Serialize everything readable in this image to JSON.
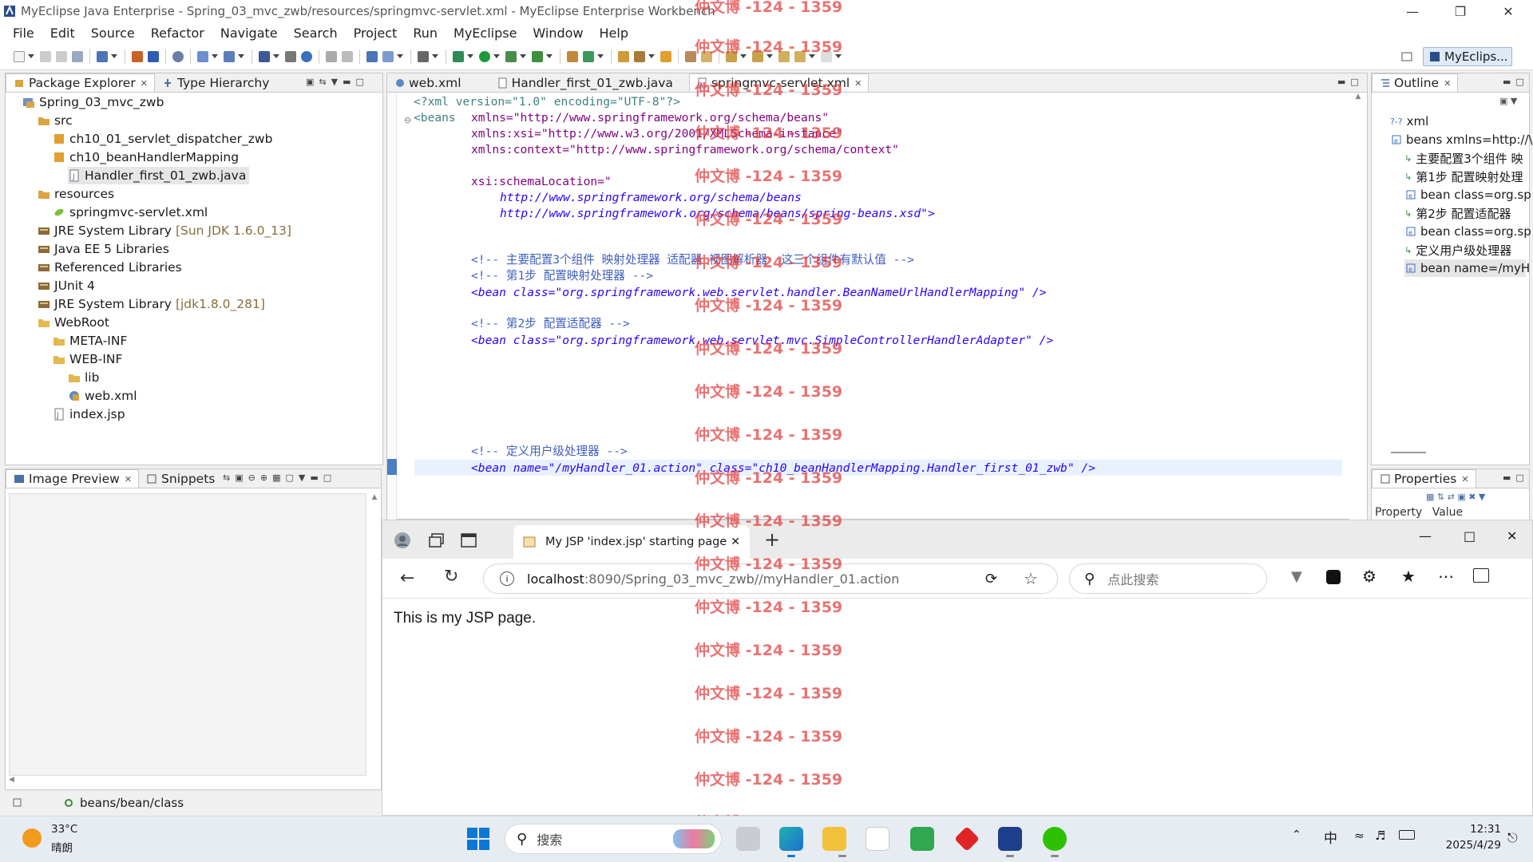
{
  "window": {
    "title": "MyEclipse Java Enterprise - Spring_03_mvc_zwb/resources/springmvc-servlet.xml - MyEclipse Enterprise Workbench"
  },
  "menu": [
    "File",
    "Edit",
    "Source",
    "Refactor",
    "Navigate",
    "Search",
    "Project",
    "Run",
    "MyEclipse",
    "Window",
    "Help"
  ],
  "perspective": {
    "label": "MyEclips..."
  },
  "package_explorer": {
    "tabs": [
      "Package Explorer",
      "Type Hierarchy"
    ],
    "tree": [
      {
        "label": "Spring_03_mvc_zwb",
        "decor": ""
      },
      {
        "label": "src",
        "decor": ""
      },
      {
        "label": "ch10_01_servlet_dispatcher_zwb",
        "decor": ""
      },
      {
        "label": "ch10_beanHandlerMapping",
        "decor": ""
      },
      {
        "label": "Handler_first_01_zwb.java",
        "decor": ""
      },
      {
        "label": "resources",
        "decor": ""
      },
      {
        "label": "springmvc-servlet.xml",
        "decor": ""
      },
      {
        "label": "JRE System Library",
        "decor": "[Sun JDK 1.6.0_13]"
      },
      {
        "label": "Java EE 5 Libraries",
        "decor": ""
      },
      {
        "label": "Referenced Libraries",
        "decor": ""
      },
      {
        "label": "JUnit 4",
        "decor": ""
      },
      {
        "label": "JRE System Library",
        "decor": "[jdk1.8.0_281]"
      },
      {
        "label": "WebRoot",
        "decor": ""
      },
      {
        "label": "META-INF",
        "decor": ""
      },
      {
        "label": "WEB-INF",
        "decor": ""
      },
      {
        "label": "lib",
        "decor": ""
      },
      {
        "label": "web.xml",
        "decor": ""
      },
      {
        "label": "index.jsp",
        "decor": ""
      }
    ]
  },
  "editor": {
    "tabs": [
      "web.xml",
      "Handler_first_01_zwb.java",
      "springmvc-servlet.xml"
    ],
    "lines": {
      "l1": "<?xml version=\"1.0\" encoding=\"UTF-8\"?>",
      "l2": "<beans",
      "l2b": "xmlns=\"http://www.springframework.org/schema/beans\"",
      "l3": "xmlns:xsi=\"http://www.w3.org/2001/XMLSchema-instance\"",
      "l4": "xmlns:context=\"http://www.springframework.org/schema/context\"",
      "l5": "xsi:schemaLocation=\"",
      "l6": "http://www.springframework.org/schema/beans",
      "l7": "http://www.springframework.org/schema/beans/spring-beans.xsd\">",
      "l8": "<!-- 主要配置3个组件 映射处理器 适配器 视图解析器  这三个组件有默认值 -->",
      "l9": "<!-- 第1步 配置映射处理器 -->",
      "l10": "<bean class=\"org.springframework.web.servlet.handler.BeanNameUrlHandlerMapping\" />",
      "l11": "<!-- 第2步 配置适配器 -->",
      "l12": "<bean class=\"org.springframework.web.servlet.mvc.SimpleControllerHandlerAdapter\" />",
      "l13": "<!-- 定义用户级处理器 -->",
      "l14": "<bean name=\"/myHandler_01.action\" class=\"ch10_beanHandlerMapping.Handler_first_01_zwb\" />"
    }
  },
  "outline": {
    "tab": "Outline",
    "items": [
      "xml",
      "beans xmlns=http://\\",
      "主要配置3个组件 映",
      "第1步 配置映射处理",
      "bean class=org.sp",
      "第2步 配置适配器",
      "bean class=org.sp",
      "定义用户级处理器",
      "bean name=/myH"
    ]
  },
  "properties": {
    "tab": "Properties",
    "cols": [
      "Property",
      "Value"
    ]
  },
  "image_preview": {
    "tabs": [
      "Image Preview",
      "Snippets"
    ]
  },
  "status": {
    "path": "beans/bean/class"
  },
  "browser": {
    "tab_title": "My JSP 'index.jsp' starting page",
    "url_host": "localhost",
    "url_rest": ":8090/Spring_03_mvc_zwb//myHandler_01.action",
    "search_placeholder": "点此搜索",
    "content": "This is my JSP page."
  },
  "watermark": "仲文博 -124 - 1359",
  "taskbar": {
    "temp": "33°C",
    "weather": "晴朗",
    "search": "搜索",
    "ime": "中",
    "time": "12:31",
    "date": "2025/4/29"
  }
}
